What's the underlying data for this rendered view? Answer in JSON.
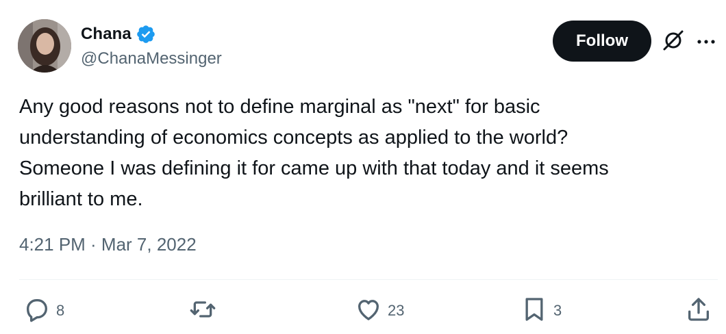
{
  "author": {
    "name": "Chana",
    "handle": "@ChanaMessinger",
    "verified": true
  },
  "follow_button": {
    "label": "Follow"
  },
  "tweet": {
    "text": "Any good reasons not to define marginal as \"next\" for basic\nunderstanding of economics concepts as applied to the world?\nSomeone I was defining it for came up with that today and it seems\nbrilliant to me.",
    "timestamp": "4:21 PM · Mar 7, 2022"
  },
  "actions": {
    "reply": {
      "icon": "reply-icon",
      "count": "8"
    },
    "retweet": {
      "icon": "retweet-icon",
      "count": ""
    },
    "like": {
      "icon": "heart-icon",
      "count": "23"
    },
    "bookmark": {
      "icon": "bookmark-icon",
      "count": "3"
    },
    "share": {
      "icon": "share-icon",
      "count": ""
    }
  },
  "colors": {
    "text": "#0f1419",
    "secondary_text": "#536471",
    "verified_badge": "#1d9bf0",
    "follow_button_bg": "#0f1419",
    "divider": "#eff3f4"
  }
}
